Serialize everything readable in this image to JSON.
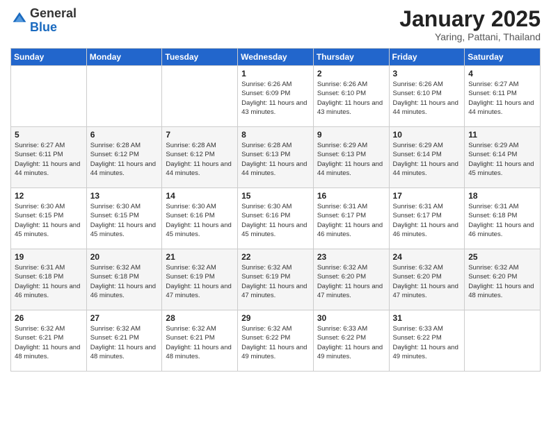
{
  "logo": {
    "general": "General",
    "blue": "Blue"
  },
  "title": {
    "month": "January 2025",
    "location": "Yaring, Pattani, Thailand"
  },
  "days_of_week": [
    "Sunday",
    "Monday",
    "Tuesday",
    "Wednesday",
    "Thursday",
    "Friday",
    "Saturday"
  ],
  "weeks": [
    [
      {
        "day": "",
        "info": ""
      },
      {
        "day": "",
        "info": ""
      },
      {
        "day": "",
        "info": ""
      },
      {
        "day": "1",
        "info": "Sunrise: 6:26 AM\nSunset: 6:09 PM\nDaylight: 11 hours and 43 minutes."
      },
      {
        "day": "2",
        "info": "Sunrise: 6:26 AM\nSunset: 6:10 PM\nDaylight: 11 hours and 43 minutes."
      },
      {
        "day": "3",
        "info": "Sunrise: 6:26 AM\nSunset: 6:10 PM\nDaylight: 11 hours and 44 minutes."
      },
      {
        "day": "4",
        "info": "Sunrise: 6:27 AM\nSunset: 6:11 PM\nDaylight: 11 hours and 44 minutes."
      }
    ],
    [
      {
        "day": "5",
        "info": "Sunrise: 6:27 AM\nSunset: 6:11 PM\nDaylight: 11 hours and 44 minutes."
      },
      {
        "day": "6",
        "info": "Sunrise: 6:28 AM\nSunset: 6:12 PM\nDaylight: 11 hours and 44 minutes."
      },
      {
        "day": "7",
        "info": "Sunrise: 6:28 AM\nSunset: 6:12 PM\nDaylight: 11 hours and 44 minutes."
      },
      {
        "day": "8",
        "info": "Sunrise: 6:28 AM\nSunset: 6:13 PM\nDaylight: 11 hours and 44 minutes."
      },
      {
        "day": "9",
        "info": "Sunrise: 6:29 AM\nSunset: 6:13 PM\nDaylight: 11 hours and 44 minutes."
      },
      {
        "day": "10",
        "info": "Sunrise: 6:29 AM\nSunset: 6:14 PM\nDaylight: 11 hours and 44 minutes."
      },
      {
        "day": "11",
        "info": "Sunrise: 6:29 AM\nSunset: 6:14 PM\nDaylight: 11 hours and 45 minutes."
      }
    ],
    [
      {
        "day": "12",
        "info": "Sunrise: 6:30 AM\nSunset: 6:15 PM\nDaylight: 11 hours and 45 minutes."
      },
      {
        "day": "13",
        "info": "Sunrise: 6:30 AM\nSunset: 6:15 PM\nDaylight: 11 hours and 45 minutes."
      },
      {
        "day": "14",
        "info": "Sunrise: 6:30 AM\nSunset: 6:16 PM\nDaylight: 11 hours and 45 minutes."
      },
      {
        "day": "15",
        "info": "Sunrise: 6:30 AM\nSunset: 6:16 PM\nDaylight: 11 hours and 45 minutes."
      },
      {
        "day": "16",
        "info": "Sunrise: 6:31 AM\nSunset: 6:17 PM\nDaylight: 11 hours and 46 minutes."
      },
      {
        "day": "17",
        "info": "Sunrise: 6:31 AM\nSunset: 6:17 PM\nDaylight: 11 hours and 46 minutes."
      },
      {
        "day": "18",
        "info": "Sunrise: 6:31 AM\nSunset: 6:18 PM\nDaylight: 11 hours and 46 minutes."
      }
    ],
    [
      {
        "day": "19",
        "info": "Sunrise: 6:31 AM\nSunset: 6:18 PM\nDaylight: 11 hours and 46 minutes."
      },
      {
        "day": "20",
        "info": "Sunrise: 6:32 AM\nSunset: 6:18 PM\nDaylight: 11 hours and 46 minutes."
      },
      {
        "day": "21",
        "info": "Sunrise: 6:32 AM\nSunset: 6:19 PM\nDaylight: 11 hours and 47 minutes."
      },
      {
        "day": "22",
        "info": "Sunrise: 6:32 AM\nSunset: 6:19 PM\nDaylight: 11 hours and 47 minutes."
      },
      {
        "day": "23",
        "info": "Sunrise: 6:32 AM\nSunset: 6:20 PM\nDaylight: 11 hours and 47 minutes."
      },
      {
        "day": "24",
        "info": "Sunrise: 6:32 AM\nSunset: 6:20 PM\nDaylight: 11 hours and 47 minutes."
      },
      {
        "day": "25",
        "info": "Sunrise: 6:32 AM\nSunset: 6:20 PM\nDaylight: 11 hours and 48 minutes."
      }
    ],
    [
      {
        "day": "26",
        "info": "Sunrise: 6:32 AM\nSunset: 6:21 PM\nDaylight: 11 hours and 48 minutes."
      },
      {
        "day": "27",
        "info": "Sunrise: 6:32 AM\nSunset: 6:21 PM\nDaylight: 11 hours and 48 minutes."
      },
      {
        "day": "28",
        "info": "Sunrise: 6:32 AM\nSunset: 6:21 PM\nDaylight: 11 hours and 48 minutes."
      },
      {
        "day": "29",
        "info": "Sunrise: 6:32 AM\nSunset: 6:22 PM\nDaylight: 11 hours and 49 minutes."
      },
      {
        "day": "30",
        "info": "Sunrise: 6:33 AM\nSunset: 6:22 PM\nDaylight: 11 hours and 49 minutes."
      },
      {
        "day": "31",
        "info": "Sunrise: 6:33 AM\nSunset: 6:22 PM\nDaylight: 11 hours and 49 minutes."
      },
      {
        "day": "",
        "info": ""
      }
    ]
  ]
}
